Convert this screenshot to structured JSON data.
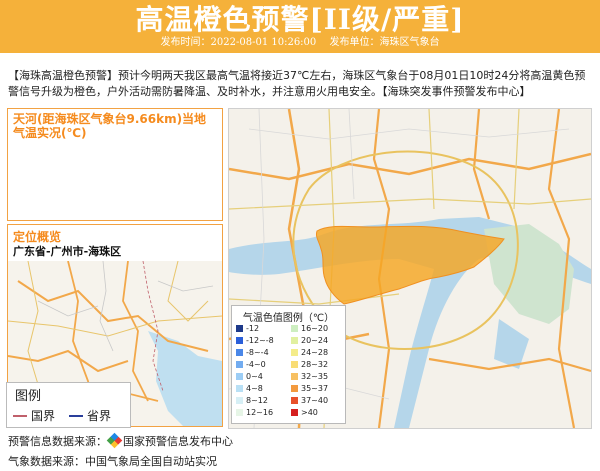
{
  "header": {
    "title": "高温橙色预警[II级/严重]",
    "publish_time": "发布时间：2022-08-01 10:26:00",
    "publisher": "发布单位：海珠区气象台"
  },
  "notice": "【海珠高温橙色预警】预计今明两天我区最高气温将接近37℃左右，海珠区气象台于08月01日10时24分将高温黄色预警信号升级为橙色，户外活动需防暑降温、及时补水，并注意用火用电安全。【海珠突发事件预警发布中心】",
  "weather_panel": {
    "title": "天河(距海珠区气象台9.66km)当地气温实况(℃)"
  },
  "location_panel": {
    "title": "定位概览",
    "location": "广东省-广州市-海珠区"
  },
  "map_legend": {
    "title": "图例",
    "national_border": "国界",
    "province_border": "省界",
    "colors": {
      "national": "#c0606b",
      "province": "#2a3f9b"
    }
  },
  "temp_legend": {
    "title": "气温色值图例（℃）",
    "items": [
      {
        "label": "-12",
        "color": "#1e3a8a"
      },
      {
        "label": "-12~-8",
        "color": "#2b5fd9"
      },
      {
        "label": "-8~-4",
        "color": "#4a87e8"
      },
      {
        "label": "-4~0",
        "color": "#72acf0"
      },
      {
        "label": "0~4",
        "color": "#9ccdf5"
      },
      {
        "label": "4~8",
        "color": "#b9e0f5"
      },
      {
        "label": "8~12",
        "color": "#d6eff5"
      },
      {
        "label": "12~16",
        "color": "#e6f5e6"
      },
      {
        "label": "16~20",
        "color": "#cdeec0"
      },
      {
        "label": "20~24",
        "color": "#e1f0a0"
      },
      {
        "label": "24~28",
        "color": "#f4ec8a"
      },
      {
        "label": "28~32",
        "color": "#f9dd75"
      },
      {
        "label": "32~35",
        "color": "#f7c062"
      },
      {
        "label": "35~37",
        "color": "#f39a3e"
      },
      {
        "label": "37~40",
        "color": "#e8502a"
      },
      {
        "label": ">40",
        "color": "#d51f1f"
      }
    ]
  },
  "footer": {
    "warning_source": "预警信息数据来源：",
    "warning_source_name": "国家预警信息发布中心",
    "weather_source": "气象数据来源：中国气象局全国自动站实况"
  }
}
